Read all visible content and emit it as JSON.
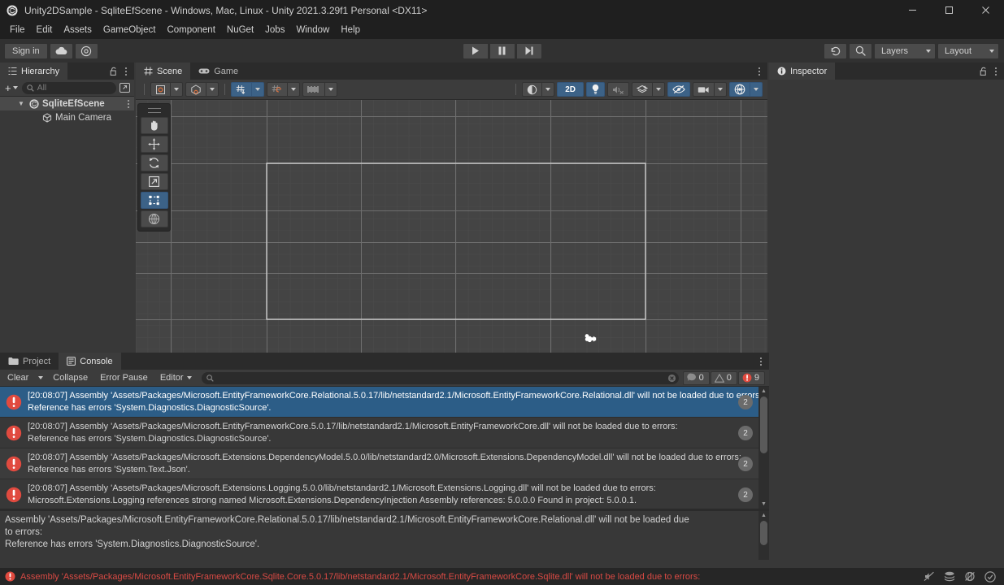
{
  "window": {
    "title": "Unity2DSample - SqliteEfScene - Windows, Mac, Linux - Unity 2021.3.29f1 Personal <DX11>",
    "logo_icon": "unity-logo-icon",
    "minimize_label": "—",
    "maximize_label": "☐",
    "close_label": "✕"
  },
  "menubar": {
    "items": [
      {
        "label": "File"
      },
      {
        "label": "Edit"
      },
      {
        "label": "Assets"
      },
      {
        "label": "GameObject"
      },
      {
        "label": "Component"
      },
      {
        "label": "NuGet"
      },
      {
        "label": "Jobs"
      },
      {
        "label": "Window"
      },
      {
        "label": "Help"
      }
    ]
  },
  "toolbar": {
    "signin_label": "Sign in",
    "cloud_icon": "cloud-icon",
    "settings_icon": "gear-icon",
    "play_icon": "play-icon",
    "pause_icon": "pause-icon",
    "step_icon": "step-icon",
    "history_icon": "undo-history-icon",
    "search_icon": "search-icon",
    "layers_label": "Layers",
    "layout_label": "Layout"
  },
  "hierarchy": {
    "tab_label": "Hierarchy",
    "tab_icon": "hierarchy-icon",
    "lock_icon": "lock-open-icon",
    "menu_icon": "kebab-menu-icon",
    "add_label": "+",
    "search_placeholder": "All",
    "search_icon": "search-icon",
    "expand_icon": "expand-icon",
    "rows": [
      {
        "label": "SqliteEfScene",
        "icon": "unity-scene-icon",
        "twisty": "▼",
        "indent": 0,
        "selected": true
      },
      {
        "label": "Main Camera",
        "icon": "gameobject-cube-icon",
        "twisty": "",
        "indent": 1,
        "selected": false
      }
    ]
  },
  "scene": {
    "tabs": [
      {
        "label": "Scene",
        "icon": "scene-grid-icon",
        "active": true
      },
      {
        "label": "Game",
        "icon": "gamepad-icon",
        "active": false
      }
    ],
    "menu_icon": "kebab-menu-icon",
    "toolbar": {
      "pivot_label": "pivot-toggle",
      "center_label": "center-toggle",
      "grid_label": "grid-snap-toggle",
      "grid_state": "on",
      "snap_increment_label": "snap-increment",
      "ruler_label": "ruler-toggle",
      "draw_mode_label": "shaded-draw-mode",
      "mode_2d_label": "2D",
      "mode_2d_state": "on",
      "lighting_label": "scene-lighting-toggle",
      "lighting_state": "on",
      "audio_label": "scene-audio-toggle",
      "audio_state": "off",
      "fx_label": "scene-effects-toggle",
      "visibility_label": "scene-visibility-toggle",
      "visibility_state": "on",
      "camera_label": "scene-camera-settings",
      "gizmos_label": "gizmos-toggle",
      "gizmos_state": "on"
    },
    "tools": [
      {
        "name": "hand-tool",
        "active": false
      },
      {
        "name": "move-tool",
        "active": false
      },
      {
        "name": "rotate-tool",
        "active": false
      },
      {
        "name": "scale-tool",
        "active": false
      },
      {
        "name": "rect-tool",
        "active": true
      },
      {
        "name": "transform-tool",
        "active": false
      }
    ],
    "gizmo_name": "main-camera-gizmo"
  },
  "inspector": {
    "tab_label": "Inspector",
    "tab_icon": "info-icon",
    "lock_icon": "lock-open-icon",
    "menu_icon": "kebab-menu-icon"
  },
  "console": {
    "tabs": [
      {
        "label": "Project",
        "icon": "folder-icon",
        "active": false
      },
      {
        "label": "Console",
        "icon": "console-icon",
        "active": true
      }
    ],
    "menu_icon": "kebab-menu-icon",
    "clear_label": "Clear",
    "collapse_label": "Collapse",
    "error_pause_label": "Error Pause",
    "editor_label": "Editor",
    "search_placeholder": "",
    "search_icon": "search-icon",
    "counts": {
      "log": "0",
      "warning": "0",
      "error": "9"
    },
    "entries": [
      {
        "line1": "[20:08:07] Assembly 'Assets/Packages/Microsoft.EntityFrameworkCore.Relational.5.0.17/lib/netstandard2.1/Microsoft.EntityFrameworkCore.Relational.dll' will not be loaded due to errors:",
        "line2": "Reference has errors 'System.Diagnostics.DiagnosticSource'.",
        "count": "2",
        "selected": true,
        "icon": "error-icon"
      },
      {
        "line1": "[20:08:07] Assembly 'Assets/Packages/Microsoft.EntityFrameworkCore.5.0.17/lib/netstandard2.1/Microsoft.EntityFrameworkCore.dll' will not be loaded due to errors:",
        "line2": "Reference has errors 'System.Diagnostics.DiagnosticSource'.",
        "count": "2",
        "selected": false,
        "icon": "error-icon"
      },
      {
        "line1": "[20:08:07] Assembly 'Assets/Packages/Microsoft.Extensions.DependencyModel.5.0.0/lib/netstandard2.0/Microsoft.Extensions.DependencyModel.dll' will not be loaded due to errors:",
        "line2": "Reference has errors 'System.Text.Json'.",
        "count": "2",
        "selected": false,
        "icon": "error-icon"
      },
      {
        "line1": "[20:08:07] Assembly 'Assets/Packages/Microsoft.Extensions.Logging.5.0.0/lib/netstandard2.1/Microsoft.Extensions.Logging.dll' will not be loaded due to errors:",
        "line2": "Microsoft.Extensions.Logging references strong named Microsoft.Extensions.DependencyInjection Assembly references: 5.0.0.0 Found in project: 5.0.0.1.",
        "count": "2",
        "selected": false,
        "icon": "error-icon"
      }
    ],
    "detail": {
      "line1": "Assembly 'Assets/Packages/Microsoft.EntityFrameworkCore.Relational.5.0.17/lib/netstandard2.1/Microsoft.EntityFrameworkCore.Relational.dll' will not be loaded due",
      "line2": "to errors:",
      "line3": "Reference has errors 'System.Diagnostics.DiagnosticSource'."
    }
  },
  "statusbar": {
    "icon": "error-icon",
    "message": "Assembly 'Assets/Packages/Microsoft.EntityFrameworkCore.Sqlite.Core.5.0.17/lib/netstandard2.1/Microsoft.EntityFrameworkCore.Sqlite.dll' will not be loaded due to errors:",
    "icons": [
      {
        "name": "no-sound-icon"
      },
      {
        "name": "layers-stack-icon"
      },
      {
        "name": "no-preview-icon"
      },
      {
        "name": "check-circle-icon"
      }
    ]
  },
  "colors": {
    "accent_blue": "#3c6287",
    "selection_blue": "#2c5d87",
    "error_red": "#d94a44",
    "panel_bg": "#383838",
    "toolbar_bg": "#3c3c3c"
  }
}
